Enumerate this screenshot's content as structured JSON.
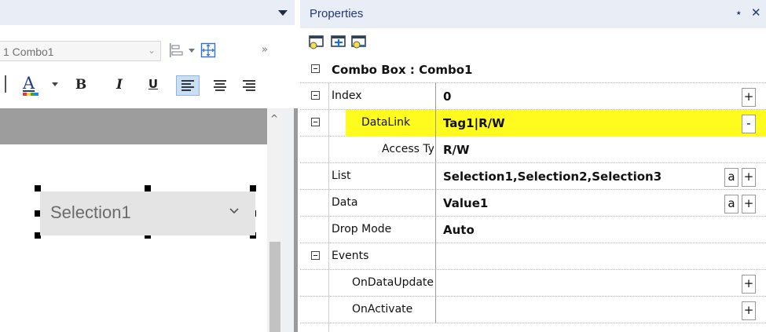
{
  "designer": {
    "combo_selector": {
      "value": "1 Combo1"
    },
    "overflow_glyph": "»",
    "toolbar": {
      "font_color_letter": "A",
      "bold": "B",
      "italic": "I",
      "underline": "U"
    },
    "widget": {
      "text": "Selection1"
    },
    "scroll_up_glyph": "^"
  },
  "properties": {
    "title": "Properties",
    "pin_glyph": "⭑",
    "close_glyph": "✕",
    "header": {
      "label": "Combo Box : Combo1"
    },
    "rows": [
      {
        "name": "Index",
        "value": "0",
        "buttons": [
          "+"
        ]
      },
      {
        "name": "DataLink",
        "value": "Tag1|R/W",
        "buttons": [
          "-"
        ]
      },
      {
        "name": "Access Type",
        "value": "R/W",
        "buttons": []
      },
      {
        "name": "List",
        "value": "Selection1,Selection2,Selection3",
        "buttons": [
          "a",
          "+"
        ]
      },
      {
        "name": "Data",
        "value": "Value1",
        "buttons": [
          "a",
          "+"
        ]
      },
      {
        "name": "Drop Mode",
        "value": "Auto",
        "buttons": []
      },
      {
        "name": "Events",
        "value": "",
        "buttons": []
      },
      {
        "name": "OnDataUpdate",
        "value": "",
        "buttons": [
          "+"
        ]
      },
      {
        "name": "OnActivate",
        "value": "",
        "buttons": [
          "+"
        ]
      }
    ],
    "highlight_color": "#fffb1f"
  }
}
